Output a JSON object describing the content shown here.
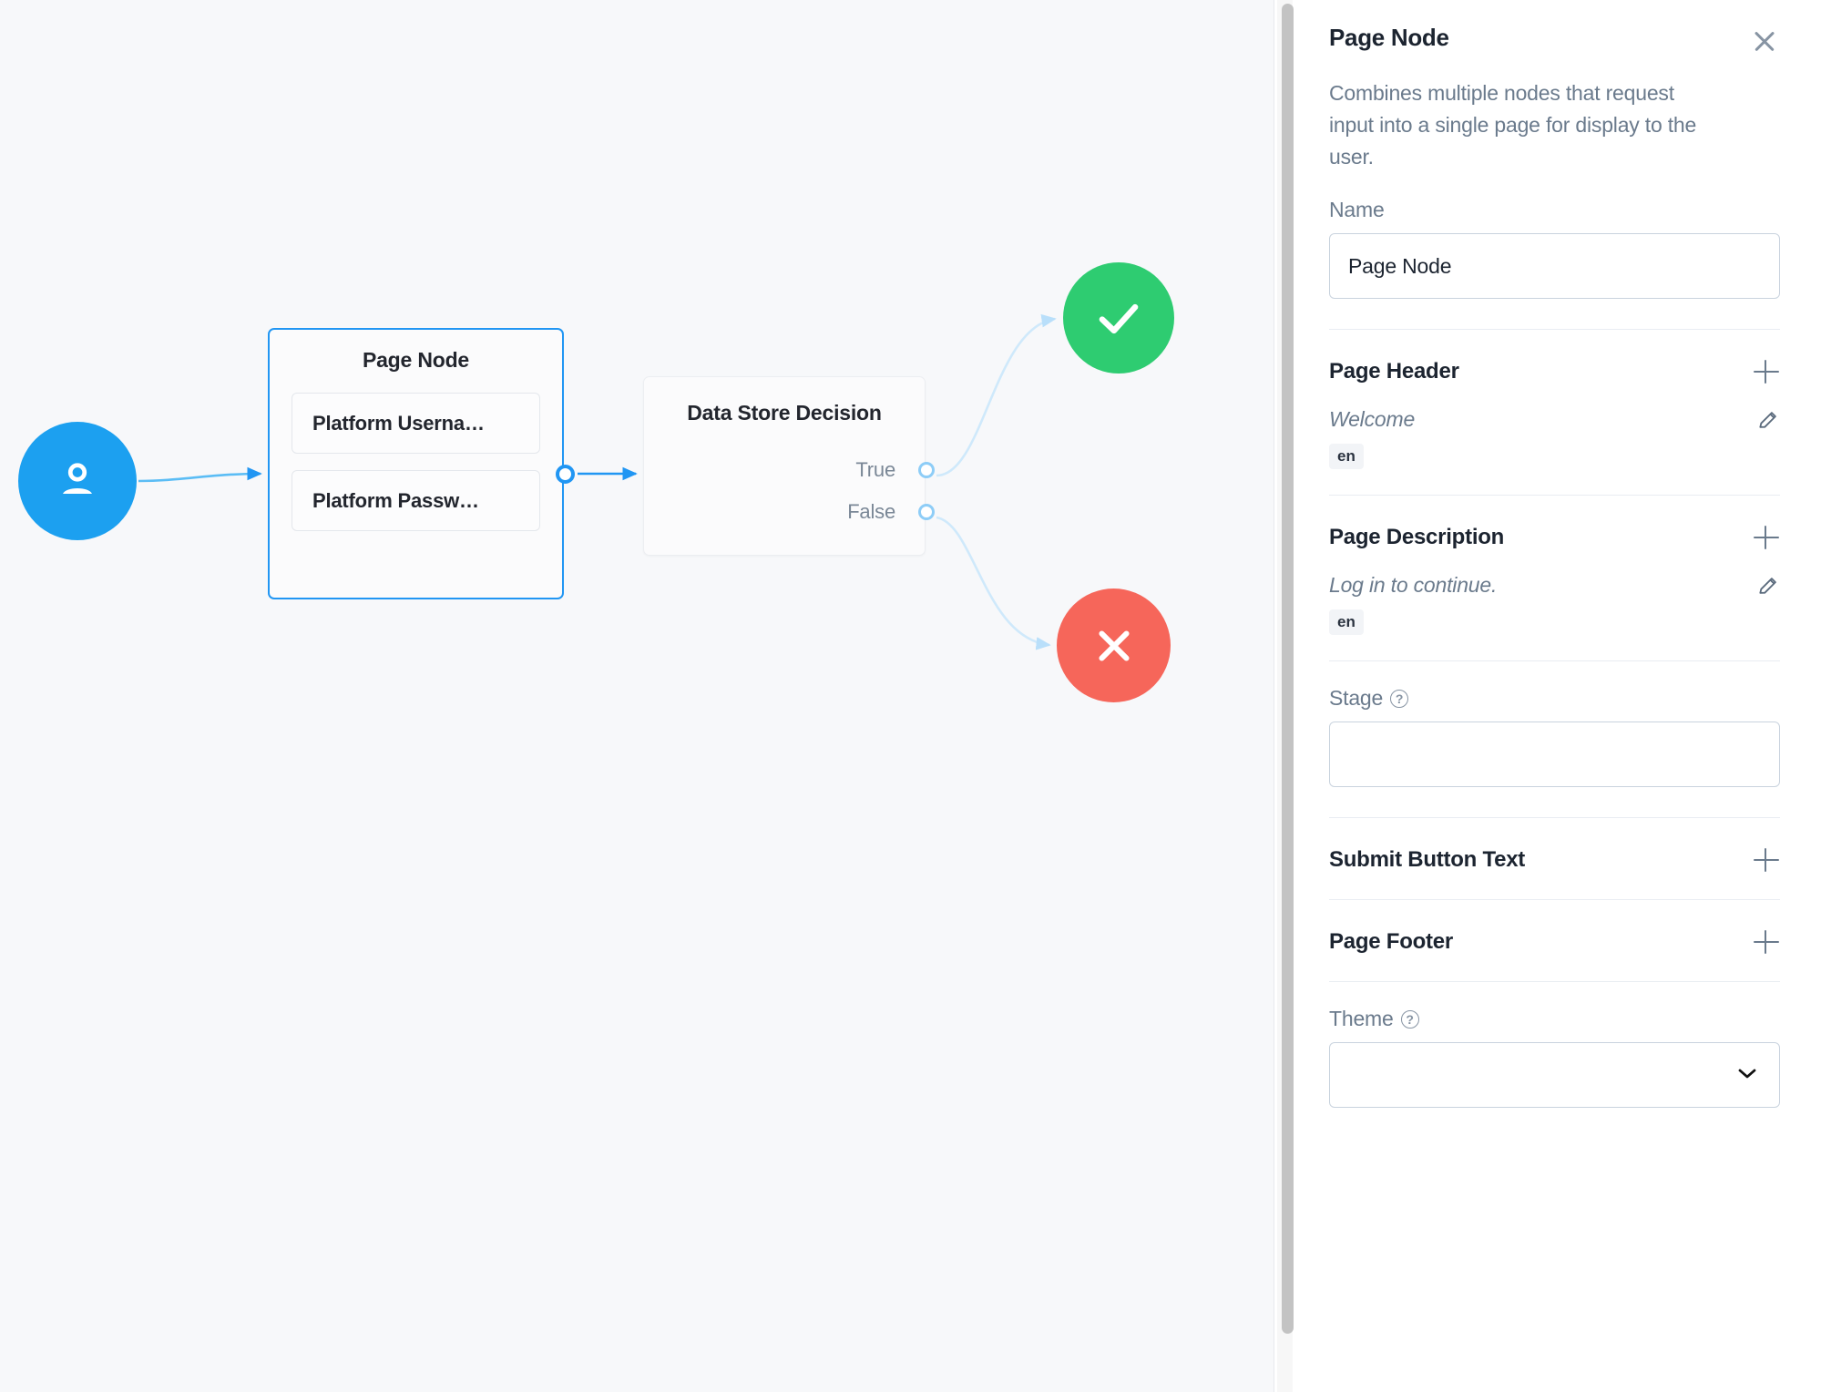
{
  "canvas": {
    "start_node": {
      "icon": "user-icon"
    },
    "page_node": {
      "title": "Page Node",
      "fields": [
        {
          "label": "Platform Userna…"
        },
        {
          "label": "Platform Passw…"
        }
      ]
    },
    "decision_node": {
      "title": "Data Store Decision",
      "outputs": [
        {
          "label": "True"
        },
        {
          "label": "False"
        }
      ]
    },
    "outcomes": [
      {
        "name": "success",
        "icon": "check-icon",
        "color": "#2ecc71"
      },
      {
        "name": "failure",
        "icon": "close-x-icon",
        "color": "#f6665a"
      }
    ],
    "colors": {
      "start_node": "#1ca0f0",
      "selected_border": "#2196f3",
      "edge": "#8ecdf7",
      "canvas_bg": "#f7f8fa"
    }
  },
  "panel": {
    "title": "Page Node",
    "close_icon": "close-icon",
    "description": "Combines multiple nodes that request input into a single page for display to the user.",
    "name_field": {
      "label": "Name",
      "value": "Page Node",
      "placeholder": ""
    },
    "page_header": {
      "title": "Page Header",
      "add_icon": "plus-icon",
      "value": "Welcome",
      "edit_icon": "pencil-icon",
      "lang": "en"
    },
    "page_description": {
      "title": "Page Description",
      "add_icon": "plus-icon",
      "value": "Log in to continue.",
      "edit_icon": "pencil-icon",
      "lang": "en"
    },
    "stage": {
      "label": "Stage",
      "help_icon": "help-icon",
      "help_glyph": "?",
      "value": "",
      "placeholder": ""
    },
    "submit_button_text": {
      "title": "Submit Button Text",
      "add_icon": "plus-icon"
    },
    "page_footer": {
      "title": "Page Footer",
      "add_icon": "plus-icon"
    },
    "theme": {
      "label": "Theme",
      "help_icon": "help-icon",
      "help_glyph": "?",
      "value": "",
      "chevron": "⌄",
      "options": []
    }
  }
}
